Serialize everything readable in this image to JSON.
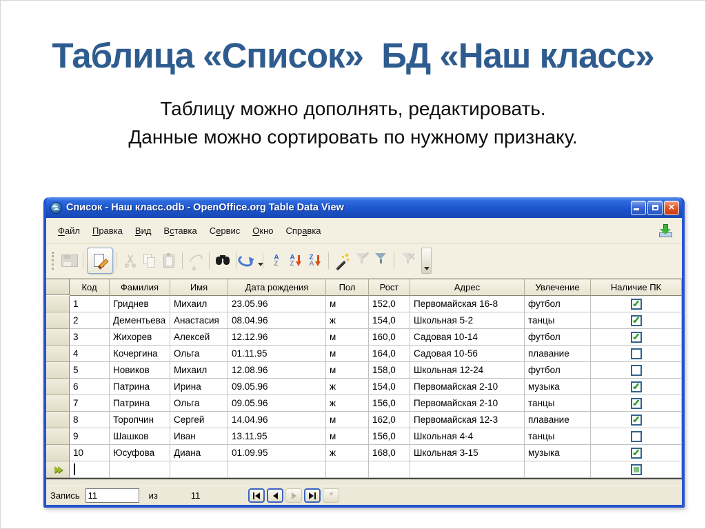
{
  "slide": {
    "title": "Таблица «Список»  БД «Наш класс»",
    "subtitle_line1": "Таблицу можно дополнять, редактировать.",
    "subtitle_line2": "Данные можно сортировать по нужному признаку."
  },
  "colors": {
    "title_text": "#2e5c8f",
    "titlebar_blue": "#1d55cc",
    "window_border": "#2453cf",
    "check_green": "#2f9e2f",
    "toolbar_bg": "#f3f0e2"
  },
  "window": {
    "title": "Список - Наш класс.odb - OpenOffice.org Table Data View",
    "controls": [
      "minimize-icon",
      "maximize-icon",
      "close-icon"
    ],
    "menu_items": [
      {
        "label": "Файл",
        "underline": 0
      },
      {
        "label": "Правка",
        "underline": 0
      },
      {
        "label": "Вид",
        "underline": 0
      },
      {
        "label": "Вставка",
        "underline": 1
      },
      {
        "label": "Сервис",
        "underline": 1
      },
      {
        "label": "Окно",
        "underline": 0
      },
      {
        "label": "Справка",
        "underline": 3
      }
    ],
    "update_icon": "update-available-icon",
    "toolbar": [
      {
        "type": "handle"
      },
      {
        "name": "save-icon",
        "cls": "ic-save",
        "enabled": false
      },
      {
        "type": "sep"
      },
      {
        "name": "edit-data-icon",
        "cls": "ic-edit",
        "enabled": true,
        "active": true
      },
      {
        "type": "sep"
      },
      {
        "name": "cut-icon",
        "cls": "ic-cut",
        "enabled": false,
        "inner": 2
      },
      {
        "name": "copy-icon",
        "cls": "ic-copy",
        "enabled": false
      },
      {
        "name": "paste-icon",
        "cls": "ic-paste",
        "enabled": false,
        "inner": 1
      },
      {
        "type": "sep"
      },
      {
        "name": "undo-icon",
        "cls": "ic-undo",
        "enabled": false
      },
      {
        "type": "sep"
      },
      {
        "name": "find-record-icon",
        "cls": "ic-find",
        "enabled": true
      },
      {
        "type": "sep"
      },
      {
        "name": "refresh-icon",
        "cls": "ic-refresh",
        "enabled": true,
        "dropdown": true
      },
      {
        "type": "sep"
      },
      {
        "name": "sort-icon",
        "letters": [
          "A",
          "Z"
        ],
        "enabled": true
      },
      {
        "name": "sort-ascending-icon",
        "letters": [
          "A",
          "Z"
        ],
        "arrow": true,
        "enabled": true
      },
      {
        "name": "sort-descending-icon",
        "letters": [
          "Z",
          "A"
        ],
        "arrow": true,
        "enabled": true
      },
      {
        "type": "sep"
      },
      {
        "name": "autofilter-icon",
        "cls": "ic-wand",
        "enabled": true,
        "inner": 3
      },
      {
        "name": "apply-filter-icon",
        "funnel": "light",
        "extra": "fwand",
        "enabled": false
      },
      {
        "name": "standard-filter-icon",
        "funnel": "normal",
        "enabled": true
      },
      {
        "type": "sep"
      },
      {
        "name": "remove-filter-icon",
        "funnel": "light",
        "extra": "fx",
        "enabled": false
      },
      {
        "type": "overflow"
      }
    ],
    "table": {
      "columns": [
        "Код",
        "Фамилия",
        "Имя",
        "Дата рождения",
        "Пол",
        "Рост",
        "Адрес",
        "Увлечение",
        "Наличие ПК"
      ],
      "rows": [
        {
          "cells": [
            "1",
            "Гриднев",
            "Михаил",
            "23.05.96",
            "м",
            "152,0",
            "Первомайская 16-8",
            "футбол"
          ],
          "pc": true
        },
        {
          "cells": [
            "2",
            "Дементьева",
            "Анастасия",
            "08.04.96",
            "ж",
            "154,0",
            "Школьная 5-2",
            "танцы"
          ],
          "pc": true
        },
        {
          "cells": [
            "3",
            "Жихорев",
            "Алексей",
            "12.12.96",
            "м",
            "160,0",
            "Садовая 10-14",
            "футбол"
          ],
          "pc": true
        },
        {
          "cells": [
            "4",
            "Кочергина",
            "Ольга",
            "01.11.95",
            "м",
            "164,0",
            "Садовая 10-56",
            "плавание"
          ],
          "pc": false
        },
        {
          "cells": [
            "5",
            "Новиков",
            "Михаил",
            "12.08.96",
            "м",
            "158,0",
            "Школьная 12-24",
            "футбол"
          ],
          "pc": false
        },
        {
          "cells": [
            "6",
            "Патрина",
            "Ирина",
            "09.05.96",
            "ж",
            "154,0",
            "Первомайская 2-10",
            "музыка"
          ],
          "pc": true
        },
        {
          "cells": [
            "7",
            "Патрина",
            "Ольга",
            "09.05.96",
            "ж",
            "156,0",
            "Первомайская 2-10",
            "танцы"
          ],
          "pc": true
        },
        {
          "cells": [
            "8",
            "Торопчин",
            "Сергей",
            "14.04.96",
            "м",
            "162,0",
            "Первомайская 12-3",
            "плавание"
          ],
          "pc": true
        },
        {
          "cells": [
            "9",
            "Шашков",
            "Иван",
            "13.11.95",
            "м",
            "156,0",
            "Школьная 4-4",
            "танцы"
          ],
          "pc": false
        },
        {
          "cells": [
            "10",
            "Юсуфова",
            "Диана",
            "01.09.95",
            "ж",
            "168,0",
            "Школьная 3-15",
            "музыка"
          ],
          "pc": true
        }
      ],
      "new_row": {
        "marker": "new-record-marker-icon",
        "caret": true,
        "pc_state": "tristate"
      }
    },
    "statusbar": {
      "record_label": "Запись",
      "record_value": "11",
      "of_label": "из",
      "total_records": "11",
      "nav_buttons": [
        {
          "name": "first-record-button",
          "glyph": "first",
          "enabled": true
        },
        {
          "name": "previous-record-button",
          "glyph": "prev",
          "enabled": true
        },
        {
          "name": "next-record-button",
          "glyph": "next",
          "enabled": false
        },
        {
          "name": "last-record-button",
          "glyph": "last",
          "enabled": true
        },
        {
          "name": "new-record-button",
          "glyph": "new",
          "enabled": false
        }
      ]
    }
  }
}
